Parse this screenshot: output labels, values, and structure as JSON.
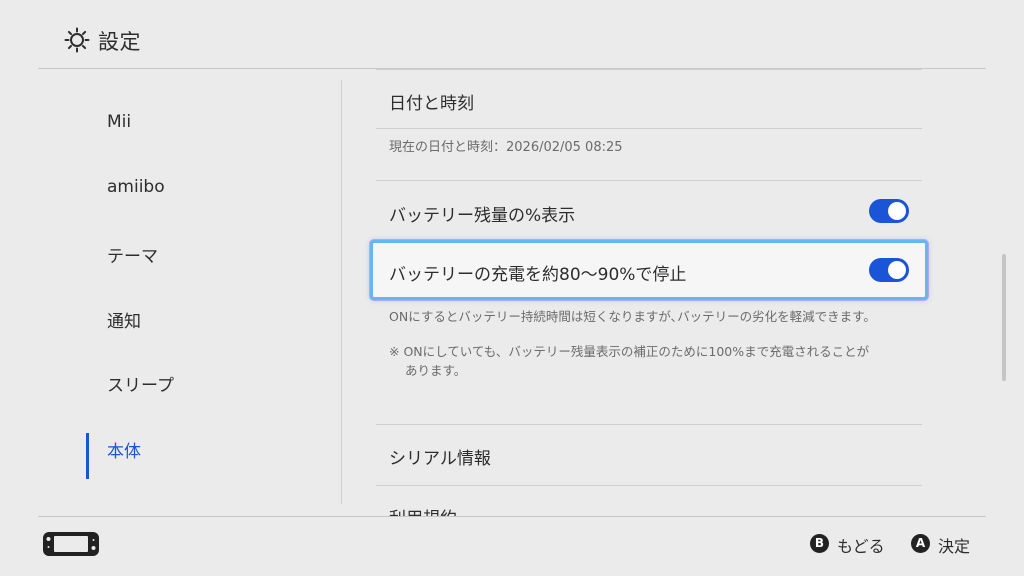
{
  "header": {
    "title": "設定",
    "icon": "gear-icon"
  },
  "sidebar": {
    "items": [
      {
        "label": "Mii"
      },
      {
        "label": "amiibo"
      },
      {
        "label": "テーマ"
      },
      {
        "label": "通知"
      },
      {
        "label": "スリープ"
      },
      {
        "label": "本体",
        "active": true
      }
    ]
  },
  "main": {
    "date_time": {
      "title": "日付と時刻",
      "current": "現在の日付と時刻：2026/02/05 08:25"
    },
    "battery_percent": {
      "label": "バッテリー残量の%表示",
      "enabled": true
    },
    "battery_limit": {
      "label": "バッテリーの充電を約80～90%で停止",
      "enabled": true
    },
    "battery_note_1": "ONにするとバッテリー持続時間は短くなりますが､バッテリーの劣化を軽減できます。",
    "battery_note_2_line1": "※ ONにしていても、バッテリー残量表示の補正のために100%まで充電されることが",
    "battery_note_2_line2": "あります。",
    "serial": {
      "title": "シリアル情報"
    },
    "terms": {
      "title": "利用規約"
    }
  },
  "footer": {
    "back": {
      "key": "B",
      "label": "もどる"
    },
    "confirm": {
      "key": "A",
      "label": "決定"
    }
  },
  "colors": {
    "accent": "#1a55d8",
    "background": "#ebebeb",
    "focus": "#63b8f2"
  }
}
